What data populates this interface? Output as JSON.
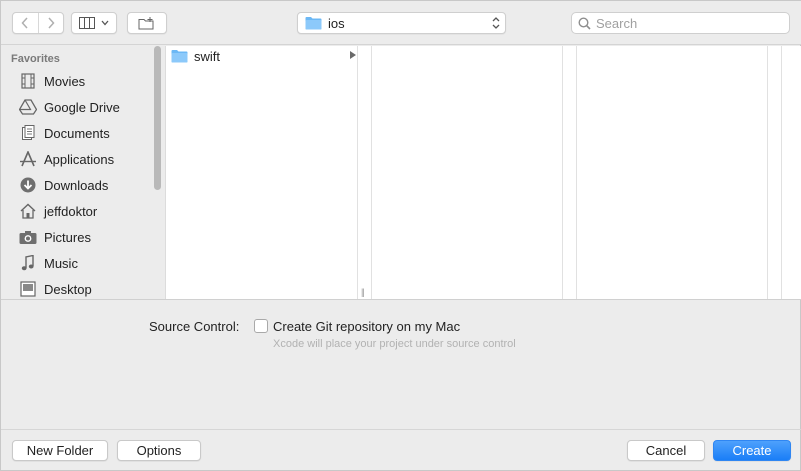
{
  "toolbar": {
    "back_icon": "chevron-left-icon",
    "forward_icon": "chevron-right-icon",
    "view_icon": "columns-view-icon",
    "new_folder_icon": "new-folder-icon",
    "path_popup": {
      "label": "ios",
      "icon": "folder-icon"
    },
    "search": {
      "placeholder": "Search",
      "value": ""
    }
  },
  "sidebar": {
    "heading": "Favorites",
    "items": [
      {
        "label": "Movies",
        "icon": "film-icon"
      },
      {
        "label": "Google Drive",
        "icon": "google-drive-icon"
      },
      {
        "label": "Documents",
        "icon": "document-icon"
      },
      {
        "label": "Applications",
        "icon": "applications-icon"
      },
      {
        "label": "Downloads",
        "icon": "download-icon"
      },
      {
        "label": "jeffdoktor",
        "icon": "home-icon"
      },
      {
        "label": "Pictures",
        "icon": "camera-icon"
      },
      {
        "label": "Music",
        "icon": "music-note-icon"
      },
      {
        "label": "Desktop",
        "icon": "desktop-icon"
      }
    ]
  },
  "browser": {
    "column1": [
      {
        "label": "swift",
        "icon": "folder-icon",
        "has_children": true
      }
    ]
  },
  "options": {
    "source_control_label": "Source Control:",
    "git_checkbox_label": "Create Git repository on my Mac",
    "git_checkbox_checked": false,
    "hint": "Xcode will place your project under source control"
  },
  "footer": {
    "new_folder": "New Folder",
    "options": "Options",
    "cancel": "Cancel",
    "create": "Create"
  },
  "colors": {
    "accent": "#1a7ef7",
    "folder": "#6cb8f5",
    "window_bg": "#ececec"
  }
}
